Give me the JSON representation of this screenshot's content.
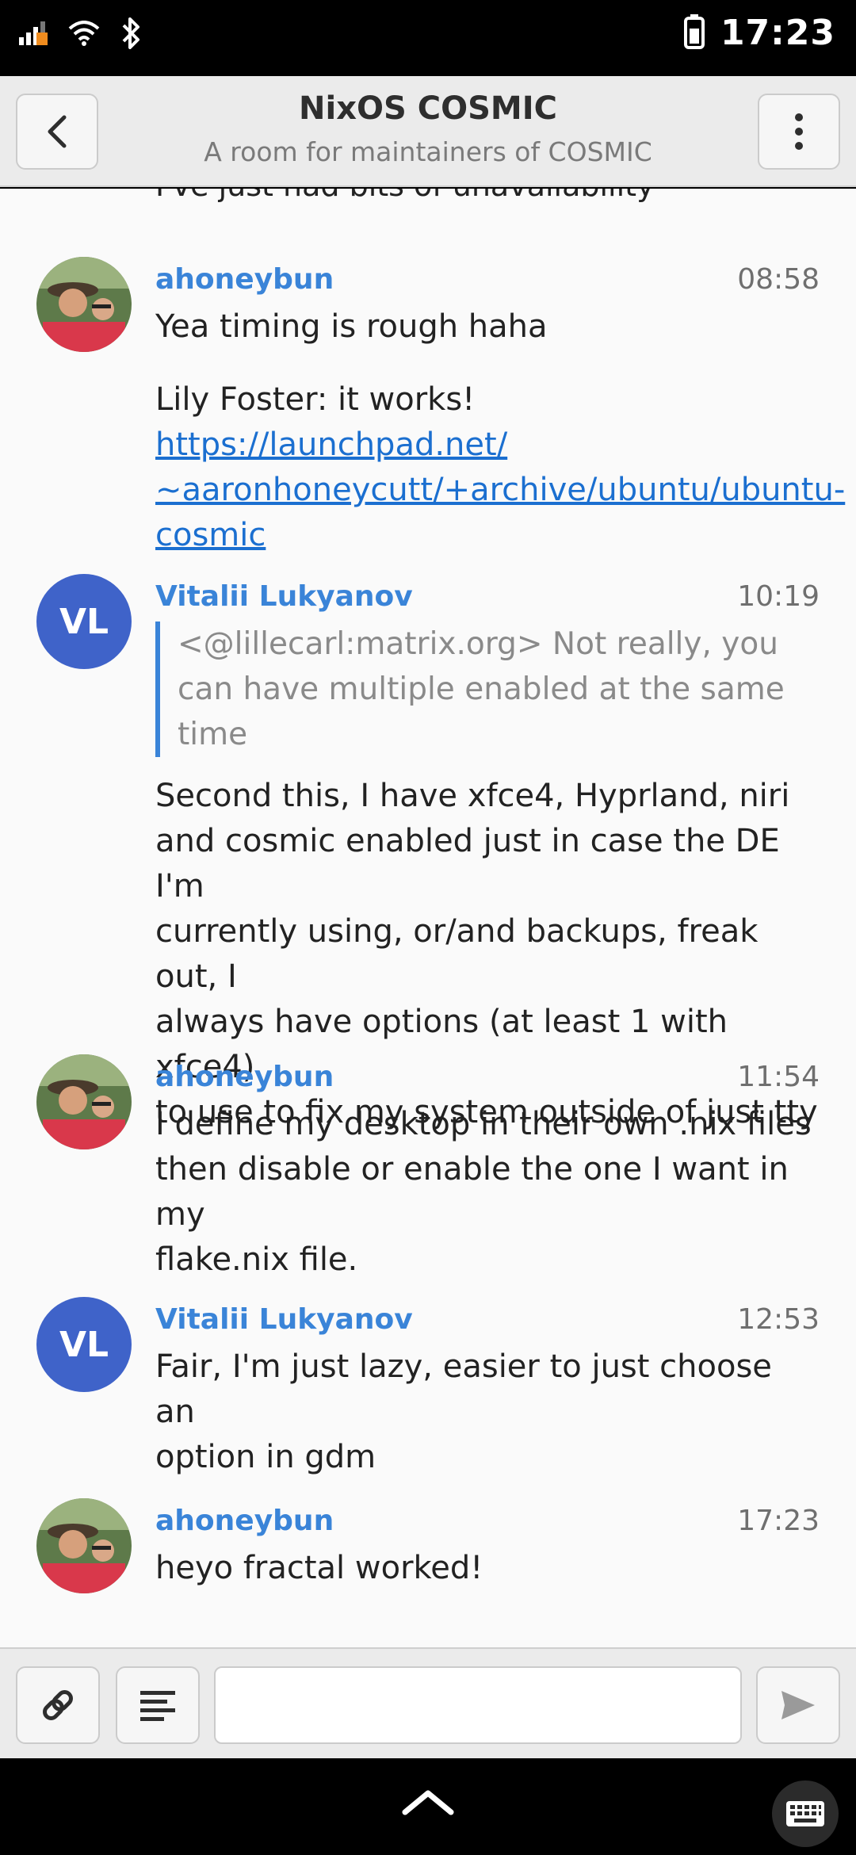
{
  "status_bar": {
    "time": "17:23",
    "icons": [
      "signal-icon",
      "wifi-icon",
      "bluetooth-icon",
      "battery-icon"
    ]
  },
  "header": {
    "title": "NixOS COSMIC",
    "subtitle": "A room for maintainers of COSMIC"
  },
  "timeline": {
    "cut_off_text": "I've just had bits of unavailability",
    "messages": [
      {
        "sender": "ahoneybun",
        "time": "08:58",
        "lines": [
          "Yea timing is rough haha"
        ],
        "second_text_prefix": "Lily Foster: it works! ",
        "second_link_lines": [
          "https://launchpad.net/",
          "~aaronhoneycutt/+archive/ubuntu/ubuntu-",
          "cosmic"
        ]
      },
      {
        "sender": "Vitalii Lukyanov",
        "avatar_initials": "VL",
        "time": "10:19",
        "quote_lines": [
          "<@lillecarl:matrix.org> Not really, you",
          "can have multiple enabled at the same",
          "time"
        ],
        "lines": [
          "Second this, I have xfce4, Hyprland, niri",
          "and cosmic enabled just in case the DE I'm",
          "currently using, or/and backups, freak out, I",
          "always have options (at least 1 with xfce4)",
          "to use to fix my system outside of just tty"
        ]
      },
      {
        "sender": "ahoneybun",
        "time": "11:54",
        "lines": [
          "I define my desktop in their own .nix files",
          "then disable or enable the one I want in my",
          "flake.nix file."
        ]
      },
      {
        "sender": "Vitalii Lukyanov",
        "avatar_initials": "VL",
        "time": "12:53",
        "lines": [
          "Fair, I'm just lazy, easier to just choose an",
          "option in gdm"
        ]
      },
      {
        "sender": "ahoneybun",
        "time": "17:23",
        "lines": [
          "heyo fractal worked!"
        ]
      }
    ]
  },
  "composer": {
    "input_value": "",
    "icons": [
      "attach-icon",
      "format-icon",
      "send-icon"
    ]
  },
  "colors": {
    "accent": "#3a84d8",
    "link": "#1b6fd0",
    "avatar_vl": "#3f63c9"
  }
}
